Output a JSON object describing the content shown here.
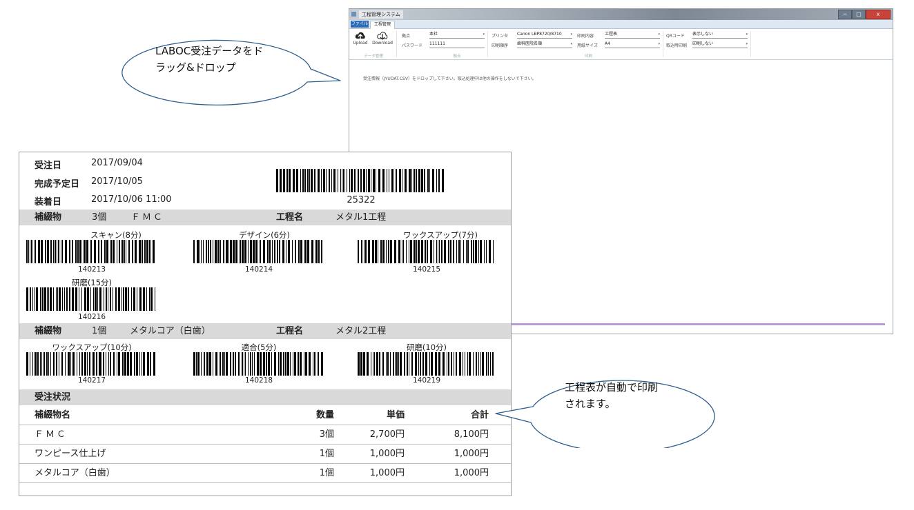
{
  "window": {
    "title": "工程管理システム",
    "min_label": "─",
    "max_label": "□",
    "close_label": "x",
    "file_tab": "ファイル",
    "tab_label": "工程管理"
  },
  "ribbon": {
    "upload_label": "Upload",
    "download_label": "Download",
    "group_data": "データ管理",
    "base_label": "拠点",
    "base_value": "本社",
    "password_label": "パスワード",
    "password_value": "111111",
    "group_base": "拠点",
    "printer_label": "プリンタ",
    "printer_value": "Canon LBP8720/8710",
    "print_order_label": "印刷順序",
    "print_order_value": "歯科医院名順",
    "print_content_label": "印刷内容",
    "print_content_value": "工程表",
    "paper_label": "用紙サイズ",
    "paper_value": "A4",
    "group_print": "印刷",
    "qr_label": "QRコード",
    "qr_value": "表示しない",
    "import_print_label": "取込時印刷",
    "import_print_value": "印刷しない"
  },
  "info_message": "受注情報（JYUDAT.CSV）をドロップして下さい。取込処理中は他の操作をしないで下さい。",
  "callouts": {
    "drop": "LABOC受注データをドラッグ&ドロップ",
    "drop_line1": "LABOC受注データをド",
    "drop_line2": "ラッグ&ドロップ",
    "print": "工程表が自動で印刷されます。",
    "print_line1": "工程表が自動で印刷",
    "print_line2": "されます。"
  },
  "sheet": {
    "order_date_label": "受注日",
    "order_date": "2017/09/04",
    "due_date_label": "完成予定日",
    "due_date": "2017/10/05",
    "fit_date_label": "装着日",
    "fit_date": "2017/10/06 11:00",
    "order_barcode_number": "25322",
    "prosthesis_label": "補綴物",
    "process_label": "工程名",
    "item1": {
      "qty": "3個",
      "name": "ＦＭＣ",
      "process": "メタル1工程",
      "steps": [
        {
          "label": "スキャン(8分)",
          "code": "140213"
        },
        {
          "label": "デザイン(6分)",
          "code": "140214"
        },
        {
          "label": "ワックスアップ(7分)",
          "code": "140215"
        },
        {
          "label": "研磨(15分)",
          "code": "140216"
        }
      ]
    },
    "item2": {
      "qty": "1個",
      "name": "メタルコア（白歯）",
      "process": "メタル2工程",
      "steps": [
        {
          "label": "ワックスアップ(10分)",
          "code": "140217"
        },
        {
          "label": "適合(5分)",
          "code": "140218"
        },
        {
          "label": "研磨(10分)",
          "code": "140219"
        }
      ]
    },
    "status_label": "受注状況",
    "table": {
      "headers": [
        "補綴物名",
        "数量",
        "単価",
        "合計"
      ],
      "rows": [
        [
          "ＦＭＣ",
          "3個",
          "2,700円",
          "8,100円"
        ],
        [
          "ワンピース仕上げ",
          "1個",
          "1,000円",
          "1,000円"
        ],
        [
          "メタルコア（白歯）",
          "1個",
          "1,000円",
          "1,000円"
        ]
      ]
    }
  },
  "colors": {
    "header_shade": "#d9d9d9",
    "file_tab": "#2f6cb6",
    "callout_stroke": "#2e5c8f",
    "progress_bar": "#b79bd6"
  }
}
